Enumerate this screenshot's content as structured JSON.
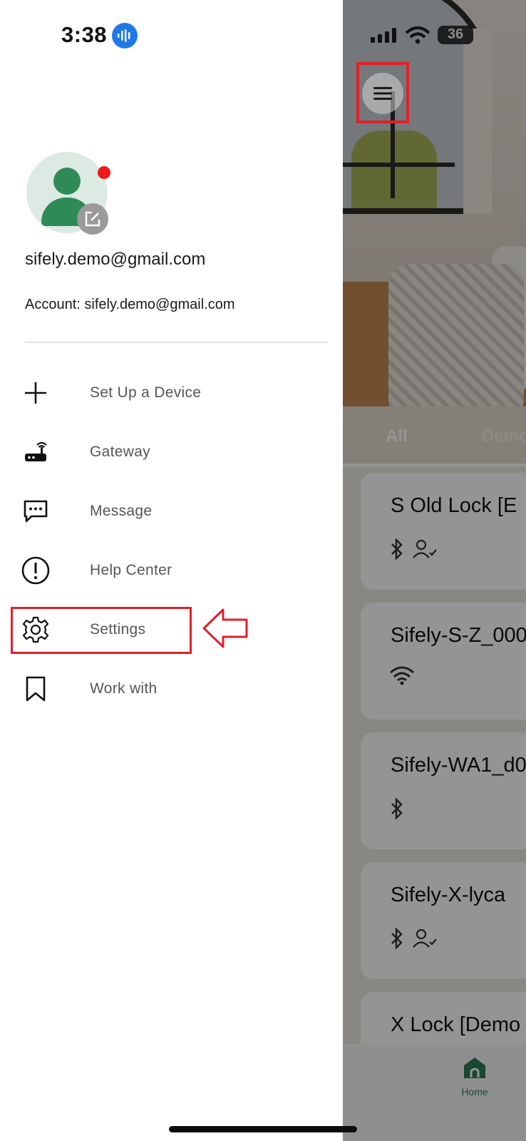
{
  "status_bar": {
    "time": "3:38",
    "battery": "36"
  },
  "profile": {
    "email": "sifely.demo@gmail.com",
    "account_line": "Account: sifely.demo@gmail.com"
  },
  "drawer_menu": [
    {
      "label": "Set Up a Device",
      "icon": "plus-icon"
    },
    {
      "label": "Gateway",
      "icon": "gateway-router-icon"
    },
    {
      "label": "Message",
      "icon": "message-icon"
    },
    {
      "label": "Help Center",
      "icon": "help-exclamation-icon"
    },
    {
      "label": "Settings",
      "icon": "gear-icon"
    },
    {
      "label": "Work with",
      "icon": "bookmark-icon"
    }
  ],
  "background": {
    "tabs": [
      "All",
      "Demo"
    ],
    "locks": [
      {
        "name": "S Old Lock [E",
        "icons": [
          "bluetooth-icon",
          "user-check-icon"
        ]
      },
      {
        "name": "Sifely-S-Z_000",
        "icons": [
          "wifi-icon"
        ]
      },
      {
        "name": "Sifely-WA1_d0",
        "icons": [
          "bluetooth-icon"
        ]
      },
      {
        "name": "Sifely-X-lyca",
        "icons": [
          "bluetooth-icon",
          "user-check-icon"
        ]
      },
      {
        "name": "X Lock [Demo",
        "icons": []
      }
    ],
    "bottom_nav": {
      "home_label": "Home"
    }
  },
  "colors": {
    "highlight": "#e0202a",
    "brand_green": "#2e8b57",
    "notification_red": "#ee1b1b"
  }
}
